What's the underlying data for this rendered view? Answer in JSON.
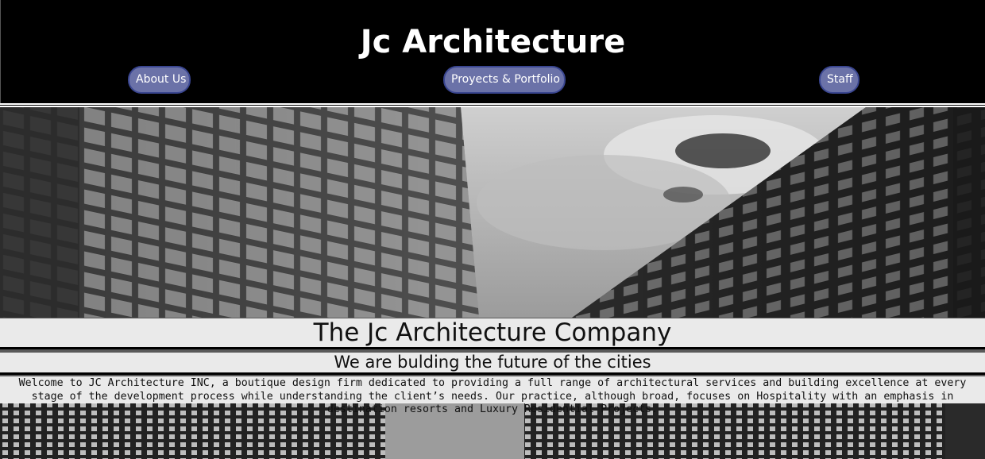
{
  "header": {
    "title": "Jc Architecture",
    "nav": [
      {
        "label": "About Us"
      },
      {
        "label": "Proyects & Portfolio"
      },
      {
        "label": "Staff"
      }
    ]
  },
  "hero": {
    "image_icon": "grayscale-skyscrapers-photo",
    "company_title": "The Jc Architecture Company",
    "tagline": "We are bulding the future of the cities",
    "description": "Welcome to JC Architecture INC, a boutique design firm dedicated to providing a full range of architectural services and building excellence at every stage of the development process while understanding the client’s needs. Our practice, although broad, focuses on Hospitality with an emphasis in destination resorts and Luxury Residential Projects."
  },
  "colors": {
    "header_bg": "#000000",
    "nav_button_bg": "#6b72a8",
    "nav_button_border": "#3a4690",
    "band_bg": "#f5f5f5"
  }
}
